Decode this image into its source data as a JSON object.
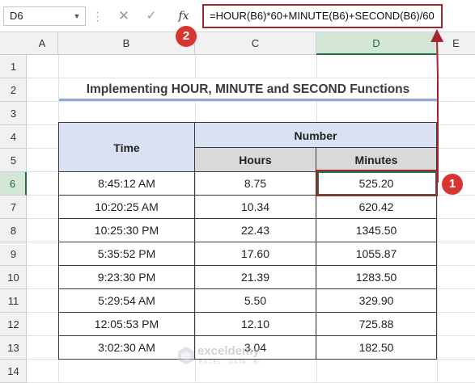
{
  "formula_bar": {
    "name_box": "D6",
    "cancel_glyph": "✕",
    "enter_glyph": "✓",
    "fx_label": "fx",
    "formula": "=HOUR(B6)*60+MINUTE(B6)+SECOND(B6)/60"
  },
  "columns": [
    "A",
    "B",
    "C",
    "D",
    "E"
  ],
  "rows": [
    "1",
    "2",
    "3",
    "4",
    "5",
    "6",
    "7",
    "8",
    "9",
    "10",
    "11",
    "12",
    "13",
    "14"
  ],
  "selected": {
    "column": "D",
    "row": "6"
  },
  "sheet": {
    "title": "Implementing HOUR, MINUTE and SECOND Functions",
    "header_time": "Time",
    "header_number": "Number",
    "header_hours": "Hours",
    "header_minutes": "Minutes",
    "data": [
      {
        "time": "8:45:12 AM",
        "hours": "8.75",
        "minutes": "525.20"
      },
      {
        "time": "10:20:25 AM",
        "hours": "10.34",
        "minutes": "620.42"
      },
      {
        "time": "10:25:30 PM",
        "hours": "22.43",
        "minutes": "1345.50"
      },
      {
        "time": "5:35:52 PM",
        "hours": "17.60",
        "minutes": "1055.87"
      },
      {
        "time": "9:23:30 PM",
        "hours": "21.39",
        "minutes": "1283.50"
      },
      {
        "time": "5:29:54 AM",
        "hours": "5.50",
        "minutes": "329.90"
      },
      {
        "time": "12:05:53 PM",
        "hours": "12.10",
        "minutes": "725.88"
      },
      {
        "time": "3:02:30 AM",
        "hours": "3.04",
        "minutes": "182.50"
      }
    ]
  },
  "annotations": {
    "badge_1": "1",
    "badge_2": "2"
  },
  "watermark": {
    "brand": "exceldemy",
    "tagline": "EXCEL · DATA · BI"
  },
  "colors": {
    "header_fill": "#d9e1f2",
    "subheader_fill": "#d9d9d9",
    "annotation_red": "#a5252b",
    "badge_red": "#d6362f",
    "title_underline": "#8ea9db",
    "excel_green": "#217346"
  }
}
